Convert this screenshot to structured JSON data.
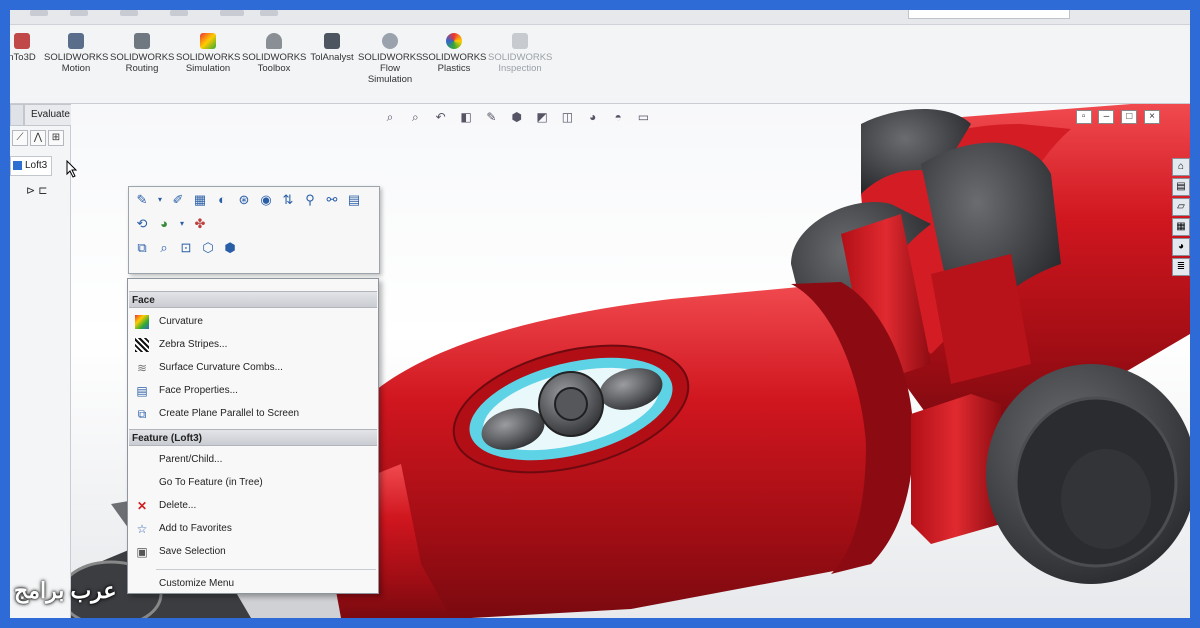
{
  "ribbon": {
    "items": [
      {
        "label": "nTo3D",
        "icon": "mbd-icon",
        "disabled": false
      },
      {
        "label": "SOLIDWORKS\nMotion",
        "icon": "motion-icon",
        "disabled": false
      },
      {
        "label": "SOLIDWORKS\nRouting",
        "icon": "routing-icon",
        "disabled": false
      },
      {
        "label": "SOLIDWORKS\nSimulation",
        "icon": "simulation-icon",
        "disabled": false
      },
      {
        "label": "SOLIDWORKS\nToolbox",
        "icon": "toolbox-icon",
        "disabled": false
      },
      {
        "label": "TolAnalyst",
        "icon": "tolanalyst-icon",
        "disabled": false
      },
      {
        "label": "SOLIDWORKS\nFlow\nSimulation",
        "icon": "flow-icon",
        "disabled": false
      },
      {
        "label": "SOLIDWORKS\nPlastics",
        "icon": "plastics-icon",
        "disabled": false
      },
      {
        "label": "SOLIDWORKS\nInspection",
        "icon": "inspection-icon",
        "disabled": true
      }
    ]
  },
  "left_panel": {
    "tab_evaluate": "Evaluate",
    "loft_tab": "Loft3"
  },
  "context_menu": {
    "face_header": "Face",
    "face_items": [
      {
        "label": "Curvature",
        "icon": "curvature-icon"
      },
      {
        "label": "Zebra Stripes...",
        "icon": "zebra-stripes-icon"
      },
      {
        "label": "Surface Curvature Combs...",
        "icon": "curvature-combs-icon"
      },
      {
        "label": "Face Properties...",
        "icon": "face-properties-icon"
      },
      {
        "label": "Create Plane Parallel to Screen",
        "icon": "plane-icon"
      }
    ],
    "feature_header": "Feature (Loft3)",
    "feature_items": [
      {
        "label": "Parent/Child...",
        "icon": ""
      },
      {
        "label": "Go To Feature (in Tree)",
        "icon": ""
      },
      {
        "label": "Delete...",
        "icon": "delete-icon"
      },
      {
        "label": "Add to Favorites",
        "icon": "favorites-icon"
      },
      {
        "label": "Save Selection",
        "icon": "save-selection-icon"
      }
    ],
    "customize": "Customize Menu"
  },
  "colors": {
    "accent": "#2e6bd6",
    "model_red": "#c8141e",
    "highlight": "#5fd3e6",
    "rubber": "#3a3b3e"
  },
  "watermark": "عرب برامج"
}
